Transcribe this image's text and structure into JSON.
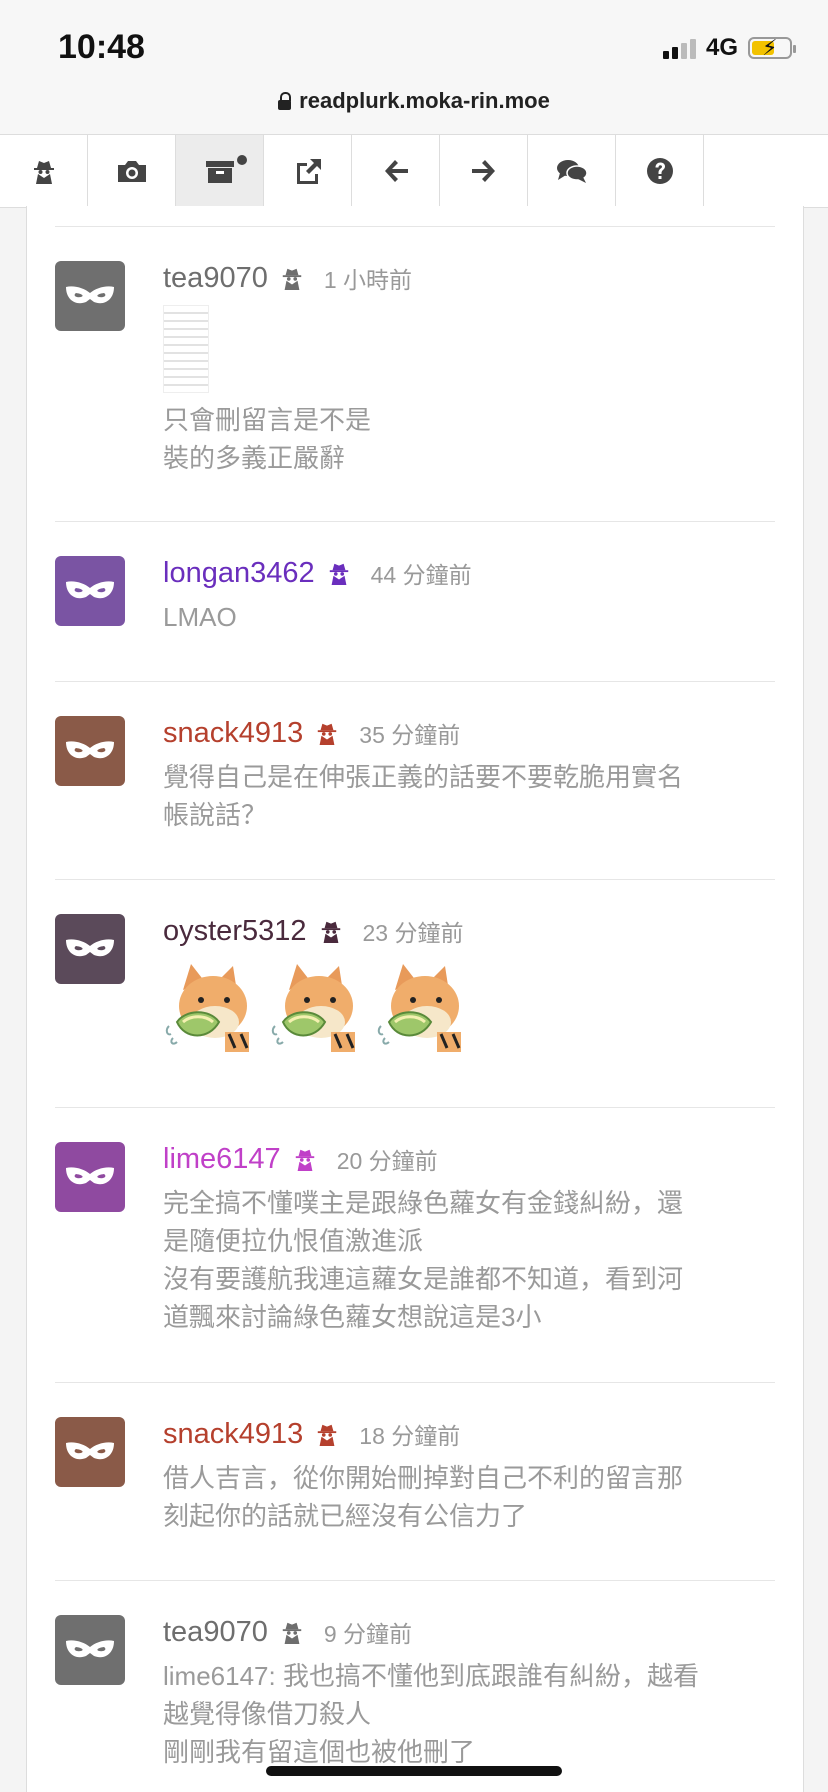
{
  "status": {
    "time": "10:48",
    "network": "4G"
  },
  "browser": {
    "url": "readplurk.moka-rin.moe"
  },
  "toolbar": {
    "buttons": [
      {
        "icon": "anonymous-spy-icon"
      },
      {
        "icon": "camera-icon"
      },
      {
        "icon": "archive-box-icon",
        "active": true
      },
      {
        "icon": "external-link-icon"
      },
      {
        "icon": "arrow-left-icon"
      },
      {
        "icon": "arrow-right-icon"
      },
      {
        "icon": "chat-bubbles-icon"
      },
      {
        "icon": "help-icon"
      }
    ]
  },
  "comments": [
    {
      "username": "tea9070",
      "time": "1 小時前",
      "text": "只會刪留言是不是\n裝的多義正嚴辭",
      "color": "#6e6e6e",
      "avatar_color": "#6f6f6f",
      "has_thumbnail": true
    },
    {
      "username": "longan3462",
      "time": "44 分鐘前",
      "text": "LMAO",
      "color": "#6a2ebd",
      "avatar_color": "#7a54a3"
    },
    {
      "username": "snack4913",
      "time": "35 分鐘前",
      "text": "覺得自己是在伸張正義的話要不要乾脆用實名\n帳說話？",
      "color": "#b5402d",
      "avatar_color": "#8a5a48"
    },
    {
      "username": "oyster5312",
      "time": "23 分鐘前",
      "text": "",
      "color": "#4a2a3d",
      "avatar_color": "#5b4a5a",
      "emotes": 3
    },
    {
      "username": "lime6147",
      "time": "20 分鐘前",
      "text": "完全搞不懂噗主是跟綠色蘿女有金錢糾紛，還\n是隨便拉仇恨值激進派\n沒有要護航我連這蘿女是誰都不知道，看到河\n道飄來討論綠色蘿女想說這是3小",
      "color": "#c040c8",
      "avatar_color": "#8f4aa0"
    },
    {
      "username": "snack4913",
      "time": "18 分鐘前",
      "text": "借人吉言，從你開始刪掉對自己不利的留言那\n刻起你的話就已經沒有公信力了",
      "color": "#b5402d",
      "avatar_color": "#8a5a48"
    },
    {
      "username": "tea9070",
      "time": "9 分鐘前",
      "text": "lime6147: 我也搞不懂他到底跟誰有糾紛，越看\n越覺得像借刀殺人\n剛剛我有留這個也被他刪了",
      "color": "#6e6e6e",
      "avatar_color": "#6f6f6f"
    }
  ]
}
